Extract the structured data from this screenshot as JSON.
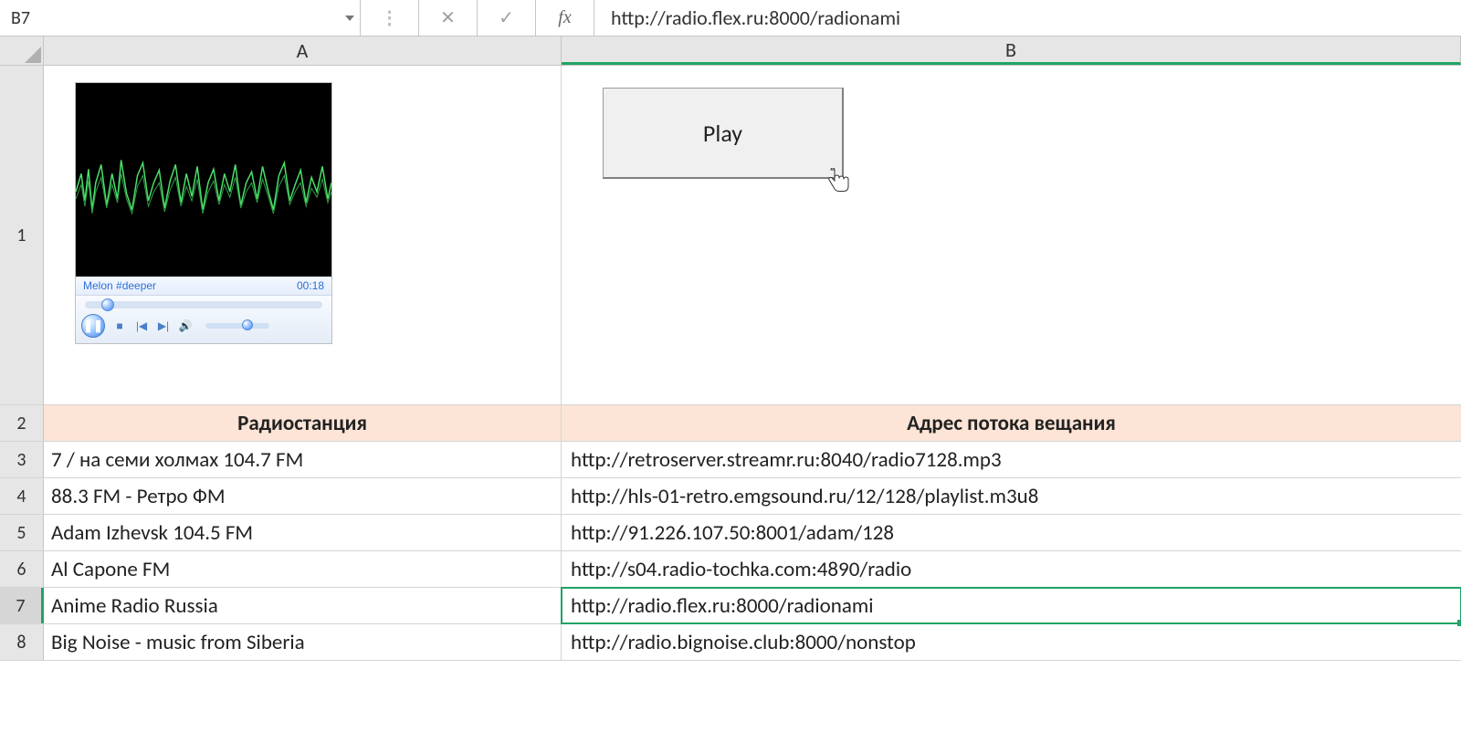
{
  "formula_bar": {
    "name_box": "B7",
    "fx_label": "fx",
    "formula_value": "http://radio.flex.ru:8000/radionami"
  },
  "columns": {
    "A": "A",
    "B": "B"
  },
  "row_numbers": [
    "1",
    "2",
    "3",
    "4",
    "5",
    "6",
    "7",
    "8"
  ],
  "header_row": {
    "A": "Радиостанция",
    "B": "Адрес потока вещания"
  },
  "stations": [
    {
      "name": "7 / на семи холмах 104.7 FM",
      "url": "http://retroserver.streamr.ru:8040/radio7128.mp3"
    },
    {
      "name": "88.3 FM - Ретро ФМ",
      "url": "http://hls-01-retro.emgsound.ru/12/128/playlist.m3u8"
    },
    {
      "name": "Adam Izhevsk 104.5 FM",
      "url": "http://91.226.107.50:8001/adam/128"
    },
    {
      "name": "Al Capone FM",
      "url": "http://s04.radio-tochka.com:4890/radio"
    },
    {
      "name": "Anime Radio Russia",
      "url": "http://radio.flex.ru:8000/radionami"
    },
    {
      "name": "Big Noise - music from Siberia",
      "url": "http://radio.bignoise.club:8000/nonstop"
    }
  ],
  "selected_row_index": 4,
  "play_button": {
    "label": "Play"
  },
  "media_player": {
    "track": "Melon #deeper",
    "elapsed": "00:18"
  }
}
